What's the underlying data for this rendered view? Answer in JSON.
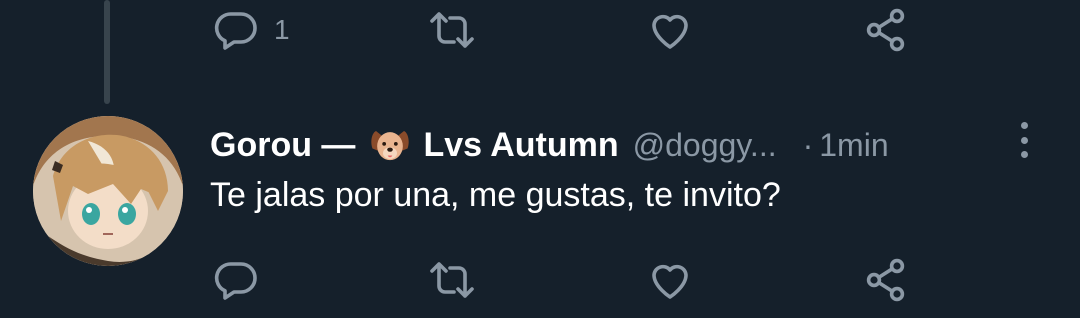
{
  "top_actions": {
    "reply_count": "1"
  },
  "tweet": {
    "display_name": "Gorou —",
    "name_emoji": "dog-face-icon",
    "name_suffix": "Lvs Autumn",
    "handle": "@doggy...",
    "separator": "·",
    "time": "1min",
    "text": "Te jalas por una, me gustas, te invito?"
  },
  "colors": {
    "background": "#15202b",
    "secondary_text": "#8b98a5",
    "primary_text": "#ffffff",
    "thread_line": "#38444d"
  }
}
